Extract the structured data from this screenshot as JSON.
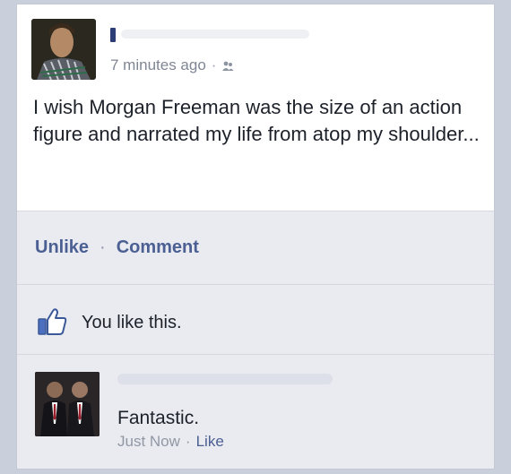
{
  "post": {
    "time": "7 minutes ago",
    "separator": "·",
    "audience_icon": "friends-icon",
    "text": "I wish Morgan Freeman was the size of an action figure and narrated my life from atop my shoulder..."
  },
  "actions": {
    "unlike_label": "Unlike",
    "separator": "·",
    "comment_label": "Comment"
  },
  "likes": {
    "icon": "thumbs-up-icon",
    "text": "You like this."
  },
  "comment": {
    "text": "Fantastic.",
    "time": "Just Now",
    "separator": "·",
    "like_label": "Like"
  },
  "colors": {
    "link": "#4b5f93",
    "card": "#e9ebf1",
    "post_bg": "#ffffff"
  }
}
